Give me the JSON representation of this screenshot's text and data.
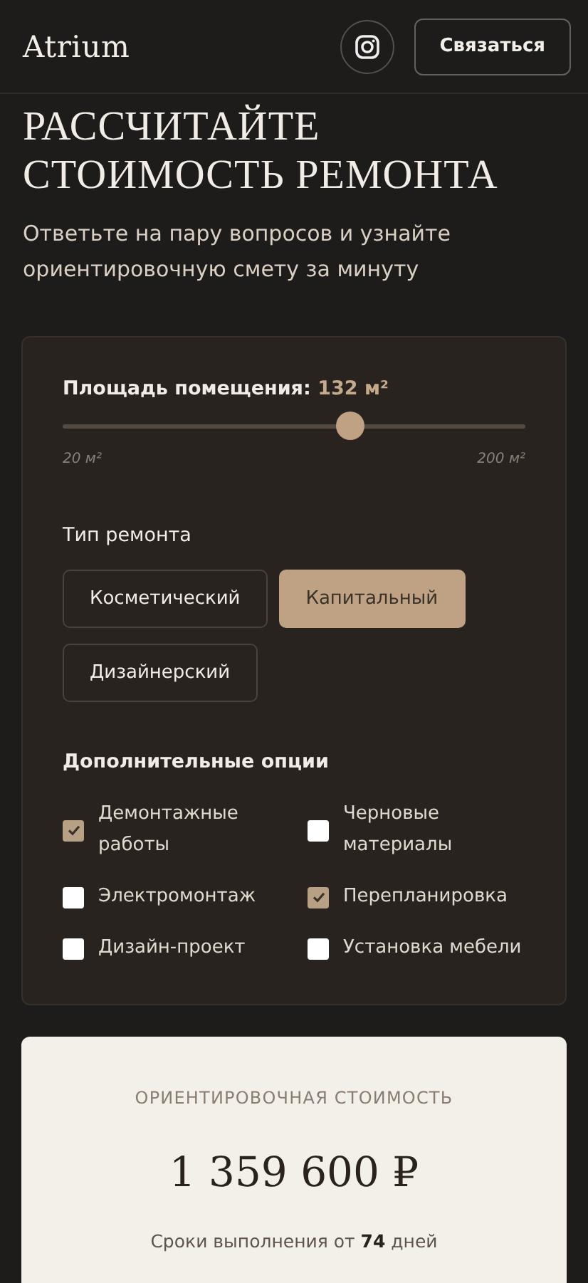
{
  "header": {
    "logo": "Atrium",
    "contact_button": "Связаться"
  },
  "hero": {
    "title": "РАССЧИТАЙТЕ СТОИМОСТЬ РЕМОНТА",
    "subtitle": "Ответьте на пару вопросов и узнайте ориентировочную смету за минуту"
  },
  "calculator": {
    "area": {
      "label": "Площадь помещения:",
      "value": "132 м²",
      "level": 0.62,
      "min_label": "20 м²",
      "max_label": "200 м²"
    },
    "repair_type": {
      "title": "Тип ремонта",
      "options": [
        {
          "label": "Косметический",
          "selected": false
        },
        {
          "label": "Капитальный",
          "selected": true
        },
        {
          "label": "Дизайнерский",
          "selected": false
        }
      ]
    },
    "extras": {
      "title": "Дополнительные опции",
      "options": [
        {
          "label": "Демонтажные работы",
          "checked": true
        },
        {
          "label": "Черновые материалы",
          "checked": false
        },
        {
          "label": "Электромонтаж",
          "checked": false
        },
        {
          "label": "Перепланировка",
          "checked": true
        },
        {
          "label": "Дизайн-проект",
          "checked": false
        },
        {
          "label": "Установка мебели",
          "checked": false
        }
      ]
    }
  },
  "result": {
    "label": "ОРИЕНТИРОВОЧНАЯ СТОИМОСТЬ",
    "price": "1 359 600 ₽",
    "duration": "Сроки выполнения от **74** дней"
  }
}
